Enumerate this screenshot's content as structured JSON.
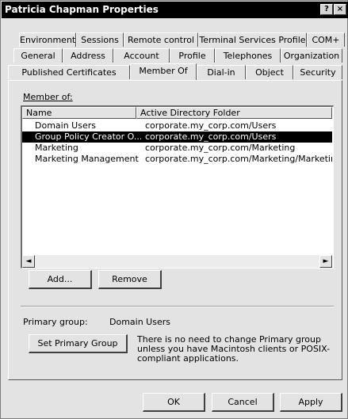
{
  "window": {
    "title": "Patricia Chapman Properties",
    "help_glyph": "?",
    "close_glyph": "×"
  },
  "tabs": {
    "row1": [
      "Environment",
      "Sessions",
      "Remote control",
      "Terminal Services Profile",
      "COM+"
    ],
    "row2": [
      "General",
      "Address",
      "Account",
      "Profile",
      "Telephones",
      "Organization"
    ],
    "row3": [
      "Published Certificates",
      "Member Of",
      "Dial-in",
      "Object",
      "Security"
    ],
    "active": "Member Of"
  },
  "member_of": {
    "label": "Member of:",
    "columns": [
      "Name",
      "Active Directory Folder"
    ],
    "rows": [
      {
        "name": "Domain Users",
        "folder": "corporate.my_corp.com/Users"
      },
      {
        "name": "Group Policy Creator O...",
        "folder": "corporate.my_corp.com/Users",
        "selected": true
      },
      {
        "name": "Marketing",
        "folder": "corporate.my_corp.com/Marketing"
      },
      {
        "name": "Marketing Management",
        "folder": "corporate.my_corp.com/Marketing/Marketing M"
      }
    ]
  },
  "buttons": {
    "add": "Add...",
    "remove": "Remove",
    "set_primary": "Set Primary Group",
    "ok": "OK",
    "cancel": "Cancel",
    "apply": "Apply"
  },
  "primary_group": {
    "label": "Primary group:",
    "value": "Domain Users",
    "notice": "There is no need to change Primary group unless you have Macintosh clients or POSIX-compliant applications."
  }
}
